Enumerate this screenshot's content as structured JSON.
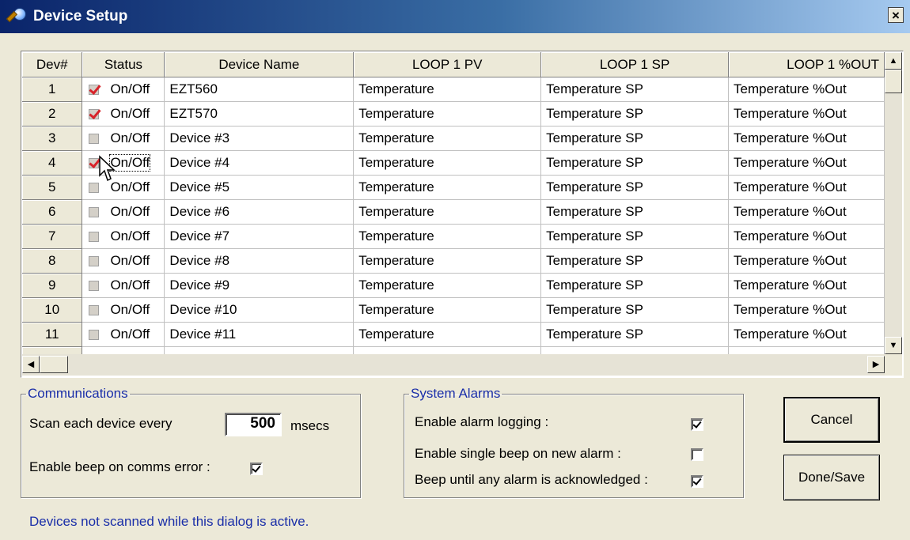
{
  "window": {
    "title": "Device Setup",
    "close_label": "×"
  },
  "grid": {
    "columns": [
      "Dev#",
      "Status",
      "Device Name",
      "LOOP 1 PV",
      "LOOP 1 SP",
      "LOOP 1 %OUT"
    ],
    "rows": [
      {
        "dev": "1",
        "checked": true,
        "status": "On/Off",
        "name": "EZT560",
        "pv": "Temperature",
        "sp": "Temperature SP",
        "out": "Temperature %Out"
      },
      {
        "dev": "2",
        "checked": true,
        "status": "On/Off",
        "name": "EZT570",
        "pv": "Temperature",
        "sp": "Temperature SP",
        "out": "Temperature %Out"
      },
      {
        "dev": "3",
        "checked": false,
        "status": "On/Off",
        "name": "Device #3",
        "pv": "Temperature",
        "sp": "Temperature SP",
        "out": "Temperature %Out"
      },
      {
        "dev": "4",
        "checked": true,
        "status": "On/Off",
        "name": "Device #4",
        "pv": "Temperature",
        "sp": "Temperature SP",
        "out": "Temperature %Out"
      },
      {
        "dev": "5",
        "checked": false,
        "status": "On/Off",
        "name": "Device #5",
        "pv": "Temperature",
        "sp": "Temperature SP",
        "out": "Temperature %Out"
      },
      {
        "dev": "6",
        "checked": false,
        "status": "On/Off",
        "name": "Device #6",
        "pv": "Temperature",
        "sp": "Temperature SP",
        "out": "Temperature %Out"
      },
      {
        "dev": "7",
        "checked": false,
        "status": "On/Off",
        "name": "Device #7",
        "pv": "Temperature",
        "sp": "Temperature SP",
        "out": "Temperature %Out"
      },
      {
        "dev": "8",
        "checked": false,
        "status": "On/Off",
        "name": "Device #8",
        "pv": "Temperature",
        "sp": "Temperature SP",
        "out": "Temperature %Out"
      },
      {
        "dev": "9",
        "checked": false,
        "status": "On/Off",
        "name": "Device #9",
        "pv": "Temperature",
        "sp": "Temperature SP",
        "out": "Temperature %Out"
      },
      {
        "dev": "10",
        "checked": false,
        "status": "On/Off",
        "name": "Device #10",
        "pv": "Temperature",
        "sp": "Temperature SP",
        "out": "Temperature %Out"
      },
      {
        "dev": "11",
        "checked": false,
        "status": "On/Off",
        "name": "Device #11",
        "pv": "Temperature",
        "sp": "Temperature SP",
        "out": "Temperature %Out"
      }
    ],
    "focused_row": 3,
    "vscroll_icons": [
      "up-arrow",
      "down-arrow"
    ],
    "hscroll_icons": [
      "left-arrow",
      "right-arrow"
    ]
  },
  "communications": {
    "title": "Communications",
    "scan_label": "Scan each device every",
    "scan_value": "500",
    "scan_unit": "msecs",
    "beep_label": "Enable beep on comms error :",
    "beep_checked": true
  },
  "alarms": {
    "title": "System Alarms",
    "logging_label": "Enable alarm logging :",
    "logging_checked": true,
    "single_beep_label": "Enable single beep on new alarm :",
    "single_beep_checked": false,
    "beep_until_label": "Beep until any alarm is acknowledged :",
    "beep_until_checked": true
  },
  "buttons": {
    "cancel": "Cancel",
    "done": "Done/Save"
  },
  "status_message": "Devices not scanned while this dialog is active.",
  "colors": {
    "accent_text": "#1a2ea8",
    "check_red": "#d8232a",
    "title_start": "#0a246a",
    "title_end": "#a6caf0"
  }
}
